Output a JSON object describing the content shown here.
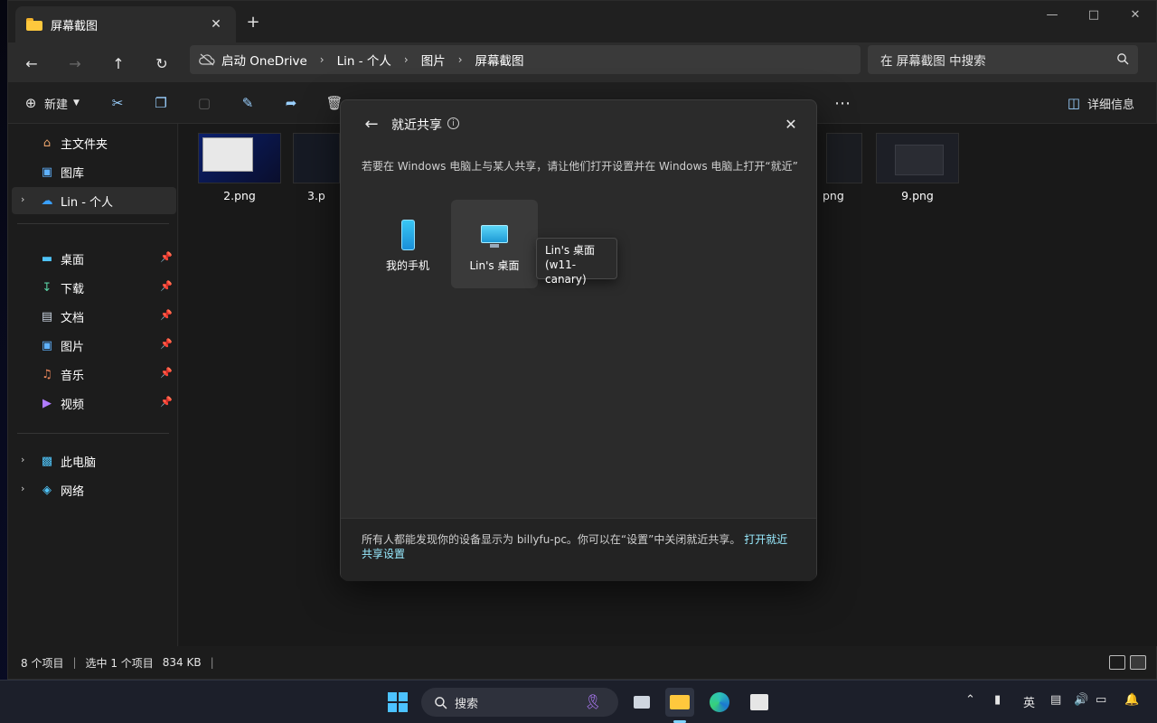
{
  "window": {
    "tab_title": "屏幕截图",
    "new_tab": "+",
    "close_tab": "✕"
  },
  "address": {
    "crumbs": [
      "启动 OneDrive",
      "Lin - 个人",
      "图片",
      "屏幕截图"
    ],
    "search_placeholder": "在 屏幕截图 中搜索"
  },
  "commands": {
    "new_label": "新建",
    "details_label": "详细信息",
    "more": "⋯"
  },
  "sidebar": {
    "items": [
      {
        "label": "主文件夹"
      },
      {
        "label": "图库"
      },
      {
        "label": "Lin - 个人"
      },
      {
        "label": "桌面"
      },
      {
        "label": "下载"
      },
      {
        "label": "文档"
      },
      {
        "label": "图片"
      },
      {
        "label": "音乐"
      },
      {
        "label": "视频"
      },
      {
        "label": "此电脑"
      },
      {
        "label": "网络"
      }
    ]
  },
  "files": [
    {
      "name": "2.png"
    },
    {
      "name": "3.p"
    },
    {
      "name": "png"
    },
    {
      "name": "9.png"
    }
  ],
  "status": {
    "count": "8 个项目",
    "selection": "选中 1 个项目",
    "size": "834 KB",
    "bar": "|"
  },
  "dialog": {
    "title": "就近共享",
    "info": "i",
    "hint": "若要在 Windows 电脑上与某人共享，请让他们打开设置并在 Windows 电脑上打开“就近”",
    "devices": [
      {
        "label": "我的手机"
      },
      {
        "label": "Lin's 桌面"
      }
    ],
    "tooltip_line1": "Lin's 桌面",
    "tooltip_line2": "(w11-canary)",
    "footer_text": "所有人都能发现你的设备显示为 billyfu-pc。你可以在“设置”中关闭就近共享。",
    "footer_link": "打开就近共享设置"
  },
  "taskbar": {
    "search_label": "搜索",
    "ime": "英"
  },
  "colors": {
    "accent_link": "#99ebff",
    "folder": "#ffc83d",
    "window_bg": "#1c1c1c"
  }
}
